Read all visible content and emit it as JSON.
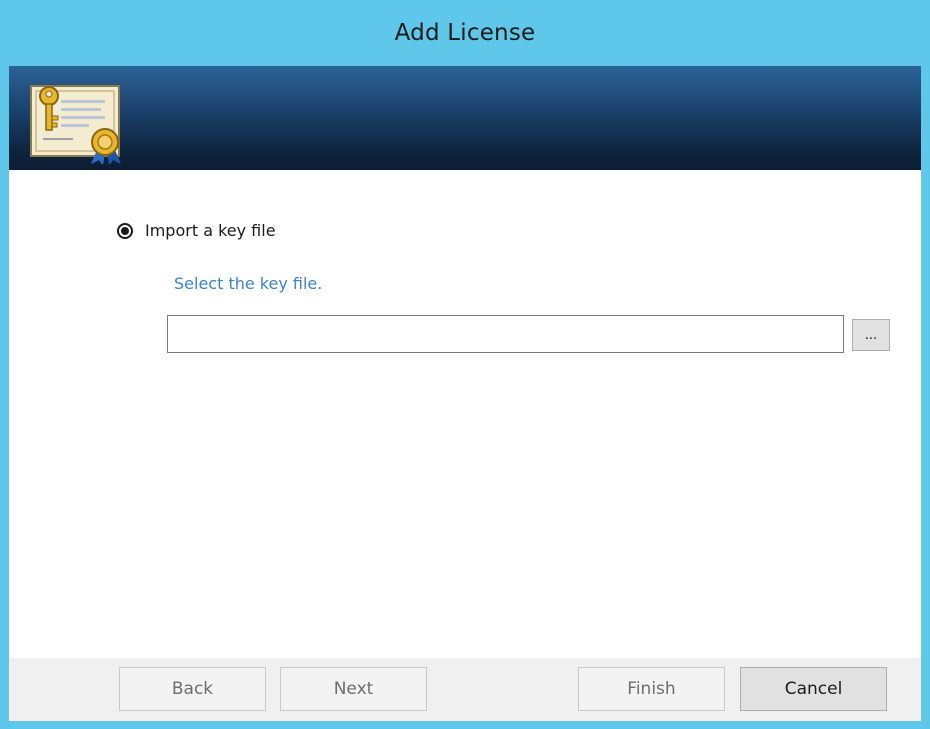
{
  "window": {
    "title": "Add License",
    "banner_icon": "license-certificate-icon",
    "accent_color": "#5fc8ea"
  },
  "import_option": {
    "label": "Import a key file",
    "selected": true
  },
  "key_file": {
    "hint": "Select the key file.",
    "value": "",
    "browse_label": "..."
  },
  "footer": {
    "back_label": "Back",
    "next_label": "Next",
    "finish_label": "Finish",
    "cancel_label": "Cancel"
  }
}
